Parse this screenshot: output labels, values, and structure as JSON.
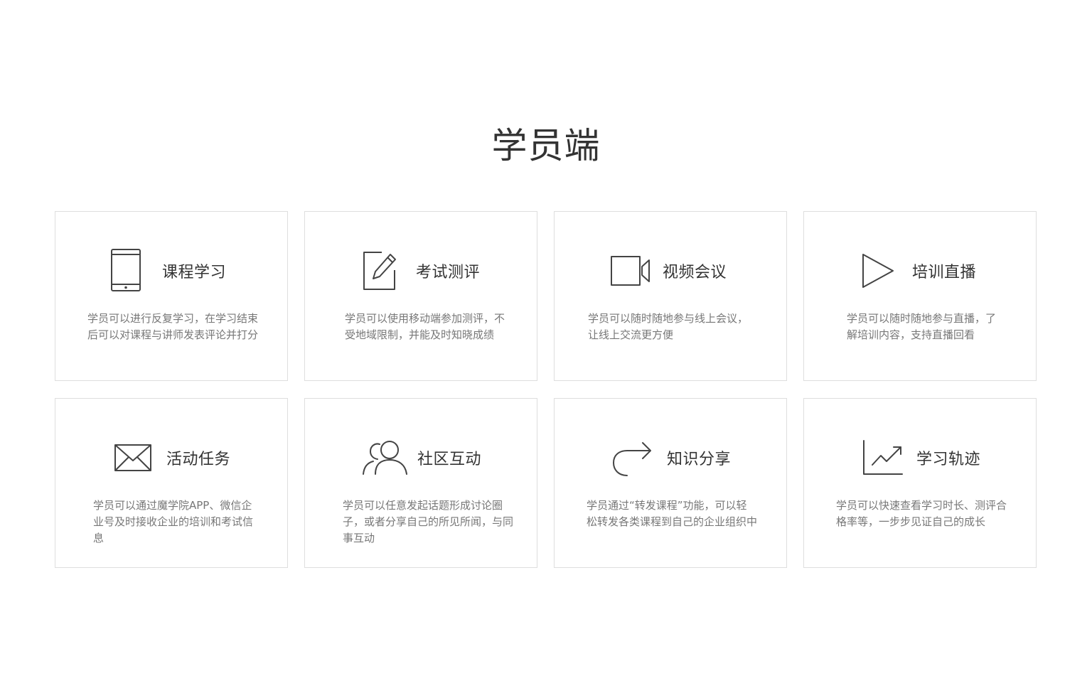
{
  "page": {
    "title": "学员端"
  },
  "cards": [
    {
      "icon": "tablet-icon",
      "title": "课程学习",
      "description": "学员可以进行反复学习，在学习结束后可以对课程与讲师发表评论并打分"
    },
    {
      "icon": "edit-icon",
      "title": "考试测评",
      "description": "学员可以使用移动端参加测评，不受地域限制，并能及时知晓成绩"
    },
    {
      "icon": "video-camera-icon",
      "title": "视频会议",
      "description": "学员可以随时随地参与线上会议，让线上交流更方便"
    },
    {
      "icon": "play-icon",
      "title": "培训直播",
      "description": "学员可以随时随地参与直播，了解培训内容，支持直播回看"
    },
    {
      "icon": "envelope-icon",
      "title": "活动任务",
      "description": "学员可以通过魔学院APP、微信企业号及时接收企业的培训和考试信息"
    },
    {
      "icon": "users-icon",
      "title": "社区互动",
      "description": "学员可以任意发起话题形成讨论圈子，或者分享自己的所见所闻，与同事互动"
    },
    {
      "icon": "share-icon",
      "title": "知识分享",
      "description": "学员通过“转发课程”功能，可以轻松转发各类课程到自己的企业组织中"
    },
    {
      "icon": "trend-chart-icon",
      "title": "学习轨迹",
      "description": "学员可以快速查看学习时长、测评合格率等，一步步见证自己的成长"
    }
  ]
}
